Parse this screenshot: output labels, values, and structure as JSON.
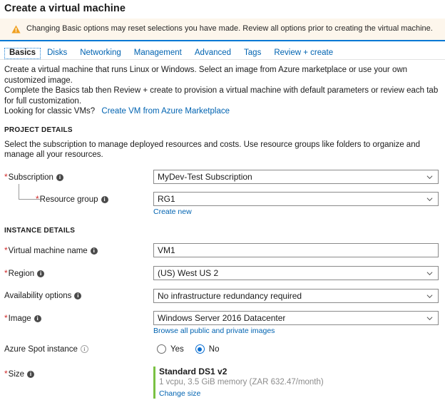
{
  "page_title": "Create a virtual machine",
  "banner": {
    "icon": "warning-triangle-icon",
    "text": "Changing Basic options may reset selections you have made. Review all options prior to creating the virtual machine."
  },
  "tabs": [
    {
      "label": "Basics",
      "active": true
    },
    {
      "label": "Disks",
      "active": false
    },
    {
      "label": "Networking",
      "active": false
    },
    {
      "label": "Management",
      "active": false
    },
    {
      "label": "Advanced",
      "active": false
    },
    {
      "label": "Tags",
      "active": false
    },
    {
      "label": "Review + create",
      "active": false
    }
  ],
  "intro": {
    "line1": "Create a virtual machine that runs Linux or Windows. Select an image from Azure marketplace or use your own customized image.",
    "line2": "Complete the Basics tab then Review + create to provision a virtual machine with default parameters or review each tab for full customization.",
    "line3_prefix": "Looking for classic VMs?",
    "line3_link": "Create VM from Azure Marketplace"
  },
  "project_details": {
    "heading": "PROJECT DETAILS",
    "description": "Select the subscription to manage deployed resources and costs. Use resource groups like folders to organize and manage all your resources.",
    "subscription": {
      "label": "Subscription",
      "required": true,
      "info": "info-icon",
      "value": "MyDev-Test Subscription"
    },
    "resource_group": {
      "label": "Resource group",
      "required": true,
      "info": "info-icon",
      "value": "RG1",
      "create_new_link": "Create new"
    }
  },
  "instance_details": {
    "heading": "INSTANCE DETAILS",
    "vm_name": {
      "label": "Virtual machine name",
      "required": true,
      "info": "info-icon",
      "value": "VM1"
    },
    "region": {
      "label": "Region",
      "required": true,
      "info": "info-icon",
      "value": "(US) West US 2"
    },
    "availability_options": {
      "label": "Availability options",
      "required": false,
      "info": "info-icon",
      "value": "No infrastructure redundancy required"
    },
    "image": {
      "label": "Image",
      "required": true,
      "info": "info-icon",
      "value": "Windows Server 2016 Datacenter",
      "browse_link": "Browse all public and private images"
    },
    "spot_instance": {
      "label": "Azure Spot instance",
      "required": false,
      "info": "info-outline-icon",
      "options": [
        {
          "label": "Yes",
          "selected": false
        },
        {
          "label": "No",
          "selected": true
        }
      ]
    },
    "size": {
      "label": "Size",
      "required": true,
      "info": "info-icon",
      "name": "Standard DS1 v2",
      "specs": "1 vcpu, 3.5 GiB memory (ZAR 632.47/month)",
      "change_link": "Change size"
    }
  },
  "colors": {
    "accent_blue": "#0078d4",
    "link_blue": "#0063b1",
    "banner_bg": "#fdf6ec",
    "warning_orange": "#f0a020",
    "required_red": "#cf2a2a",
    "size_green": "#7ac143"
  }
}
